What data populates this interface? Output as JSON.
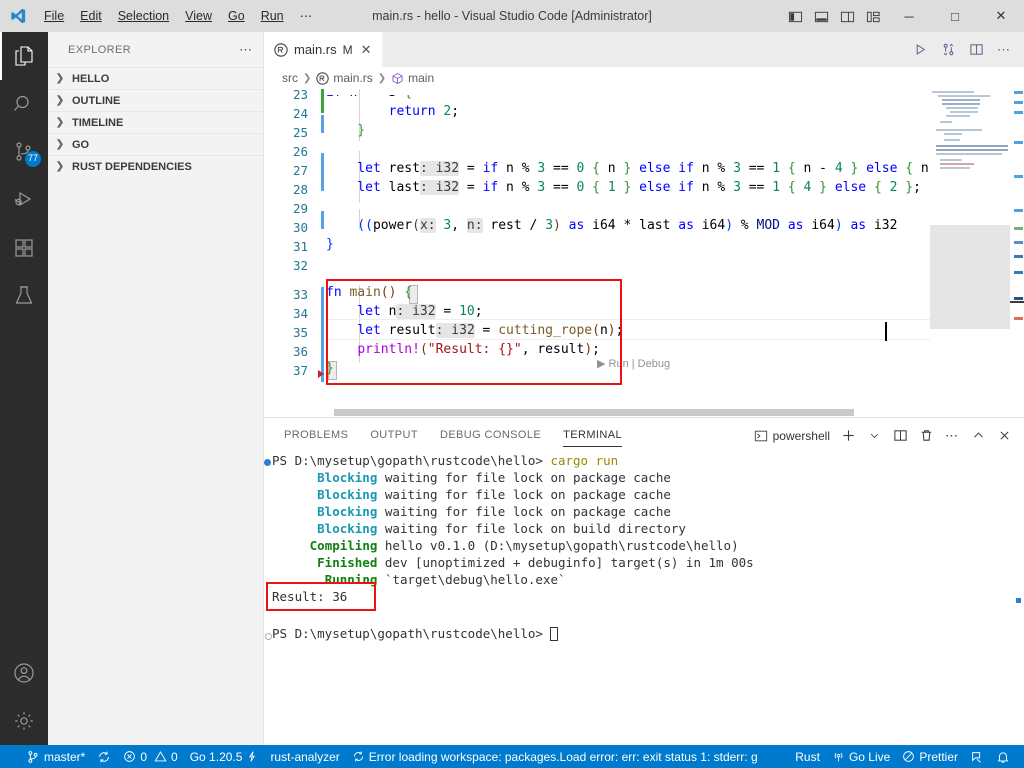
{
  "window": {
    "title": "main.rs - hello - Visual Studio Code [Administrator]",
    "menus": [
      "File",
      "Edit",
      "Selection",
      "View",
      "Go",
      "Run",
      "⋯"
    ],
    "layout_buttons": [
      "toggle-primary-sidebar",
      "toggle-panel",
      "toggle-secondary-sidebar",
      "customize-layout"
    ],
    "controls": {
      "minimize": "─",
      "maximize": "□",
      "close": "✕"
    }
  },
  "activitybar": {
    "items": [
      {
        "name": "explorer",
        "icon": "files-icon",
        "active": true,
        "badge": ""
      },
      {
        "name": "search",
        "icon": "search-icon",
        "active": false,
        "badge": ""
      },
      {
        "name": "source-control",
        "icon": "source-control-icon",
        "active": false,
        "badge": "77"
      },
      {
        "name": "run-and-debug",
        "icon": "debug-icon",
        "active": false,
        "badge": ""
      },
      {
        "name": "extensions",
        "icon": "extensions-icon",
        "active": false,
        "badge": ""
      },
      {
        "name": "testing",
        "icon": "beaker-icon",
        "active": false,
        "badge": ""
      }
    ],
    "bottom": [
      {
        "name": "accounts",
        "icon": "account-icon"
      },
      {
        "name": "manage",
        "icon": "gear-icon"
      }
    ]
  },
  "sidebar": {
    "title": "EXPLORER",
    "more_actions": "⋯",
    "sections": [
      {
        "label": "HELLO",
        "expanded": false
      },
      {
        "label": "OUTLINE",
        "expanded": false
      },
      {
        "label": "TIMELINE",
        "expanded": false
      },
      {
        "label": "GO",
        "expanded": false
      },
      {
        "label": "RUST DEPENDENCIES",
        "expanded": false
      }
    ]
  },
  "editor": {
    "tab": {
      "label": "main.rs",
      "dirty_badge": "M",
      "close": "✕",
      "icon": "rust-file-icon"
    },
    "actions": [
      "run-code-icon",
      "run-debug-icon",
      "split-editor-icon",
      "more-actions-icon"
    ],
    "breadcrumb": [
      {
        "label": "src",
        "icon": ""
      },
      {
        "label": "main.rs",
        "icon": "rust-file-icon"
      },
      {
        "label": "main",
        "icon": "symbol-function-icon"
      }
    ],
    "codelens": "▶ Run | Debug",
    "first_visible_line": 23,
    "lines": [
      {
        "no": 23,
        "clipped": true
      },
      {
        "no": 24
      },
      {
        "no": 25
      },
      {
        "no": 26
      },
      {
        "no": 27
      },
      {
        "no": 28
      },
      {
        "no": 29
      },
      {
        "no": 30
      },
      {
        "no": 31
      },
      {
        "no": 32
      },
      {
        "no": 33
      },
      {
        "no": 34
      },
      {
        "no": 35
      },
      {
        "no": 36
      },
      {
        "no": 37
      }
    ],
    "text": {
      "l24": "        return 2;",
      "l25": "    }",
      "l27_a": "    let rest",
      "l27_hint": ": i32",
      "l27_b": " = if n % 3 == 0 { n } else if n % 3 == 1 { n - 4 } else { n",
      "l28_a": "    let last",
      "l28_hint": ": i32",
      "l28_b": " = if n % 3 == 0 { 1 } else if n % 3 == 1 { 4 } else { 2 };",
      "l30": "    ((power(x: 3, n: rest / 3) as i64 * last as i64) % MOD as i64) as i32",
      "l31": "}",
      "l33": "fn main() {",
      "l34_a": "    let n",
      "l34_hint": ": i32",
      "l34_b": " = 10;",
      "l35_a": "    let result",
      "l35_hint": ": i32",
      "l35_b": " = cutting_rope(n);",
      "l36": "    println!(\"Result: {}\", result);",
      "l37": "}"
    }
  },
  "panel": {
    "tabs": [
      {
        "label": "PROBLEMS",
        "active": false
      },
      {
        "label": "OUTPUT",
        "active": false
      },
      {
        "label": "DEBUG CONSOLE",
        "active": false
      },
      {
        "label": "TERMINAL",
        "active": true
      }
    ],
    "terminal_name": "powershell",
    "actions": [
      "new-terminal-icon",
      "terminal-dropdown-icon",
      "split-terminal-icon",
      "kill-terminal-icon",
      "more-actions-icon",
      "maximize-panel-icon",
      "close-panel-icon"
    ],
    "terminal_lines": [
      {
        "prompt": "PS D:\\mysetup\\gopath\\rustcode\\hello> ",
        "cmd": "cargo run",
        "marker": "success"
      },
      {
        "tag": "Blocking",
        "tag_color": "cyan",
        "text": " waiting for file lock on package cache"
      },
      {
        "tag": "Blocking",
        "tag_color": "cyan",
        "text": " waiting for file lock on package cache"
      },
      {
        "tag": "Blocking",
        "tag_color": "cyan",
        "text": " waiting for file lock on package cache"
      },
      {
        "tag": "Blocking",
        "tag_color": "cyan",
        "text": " waiting for file lock on build directory"
      },
      {
        "tag": "Compiling",
        "tag_color": "green",
        "text": " hello v0.1.0 (D:\\mysetup\\gopath\\rustcode\\hello)"
      },
      {
        "tag": "Finished",
        "tag_color": "green",
        "text": " dev [unoptimized + debuginfo] target(s) in 1m 00s"
      },
      {
        "tag": "Running",
        "tag_color": "green",
        "text": " `target\\debug\\hello.exe`"
      },
      {
        "tag": "",
        "tag_color": "",
        "text": "Result: 36"
      },
      {
        "prompt": "PS D:\\mysetup\\gopath\\rustcode\\hello> ",
        "cmd": "",
        "marker": "pending"
      }
    ],
    "highlighted_output": "Result: 36"
  },
  "statusbar": {
    "left": [
      {
        "name": "remote",
        "icon": "",
        "label": ""
      },
      {
        "name": "branch",
        "icon": "source-control-icon",
        "label": "master*"
      },
      {
        "name": "sync",
        "icon": "sync-icon",
        "label": ""
      },
      {
        "name": "problems",
        "icon": "errors-warnings-icon",
        "label": "0  0",
        "errors": "0",
        "warnings": "0"
      },
      {
        "name": "go-version",
        "icon": "",
        "label": "Go 1.20.5"
      },
      {
        "name": "rust-analyzer",
        "icon": "",
        "label": "rust-analyzer"
      },
      {
        "name": "go-workspace-error",
        "icon": "sync-icon",
        "label": "Error loading workspace: packages.Load error: err: exit status 1: stderr: g"
      }
    ],
    "right": [
      {
        "name": "language-mode",
        "icon": "",
        "label": "Rust"
      },
      {
        "name": "go-live",
        "icon": "broadcast-icon",
        "label": "Go Live"
      },
      {
        "name": "prettier",
        "icon": "prettier-icon",
        "label": "Prettier"
      },
      {
        "name": "feedback",
        "icon": "feedback-icon",
        "label": ""
      },
      {
        "name": "notifications",
        "icon": "bell-icon",
        "label": ""
      }
    ]
  },
  "colors": {
    "accent": "#007acc",
    "titlebar": "#dddddd",
    "sidebar": "#f3f3f3",
    "activitybar": "#2c2c2c",
    "annotation": "#ee1111"
  }
}
